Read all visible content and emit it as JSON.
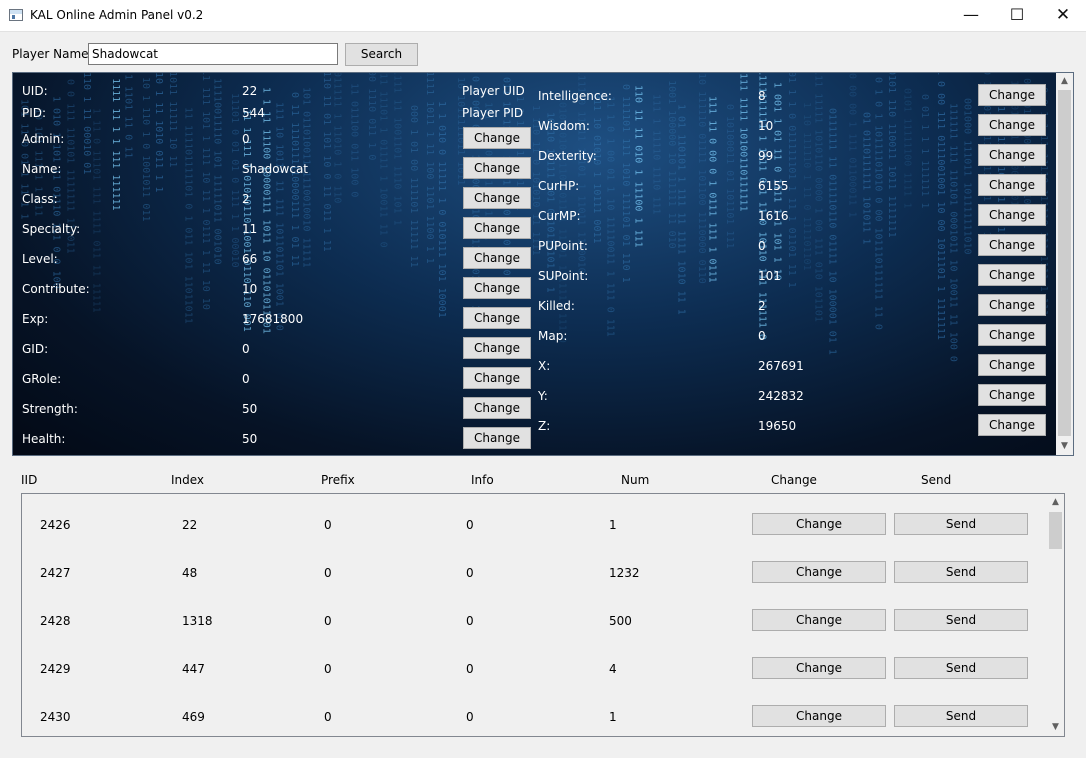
{
  "window": {
    "title": "KAL Online Admin Panel v0.2",
    "min_glyph": "—",
    "max_glyph": "☐",
    "close_glyph": "✕"
  },
  "search": {
    "label": "Player Name:",
    "value": "Shadowcat",
    "button": "Search"
  },
  "stats_left": [
    {
      "label": "UID:",
      "value": "22"
    },
    {
      "label": "PID:",
      "value": "544"
    },
    {
      "label": "Admin:",
      "value": "0"
    },
    {
      "label": "Name:",
      "value": "Shadowcat"
    },
    {
      "label": "Class:",
      "value": "2"
    },
    {
      "label": "Specialty:",
      "value": "11"
    },
    {
      "label": "Level:",
      "value": "66"
    },
    {
      "label": "Contribute:",
      "value": "10"
    },
    {
      "label": "Exp:",
      "value": "17681800"
    },
    {
      "label": "GID:",
      "value": "0"
    },
    {
      "label": "GRole:",
      "value": "0"
    },
    {
      "label": "Strength:",
      "value": "50"
    },
    {
      "label": "Health:",
      "value": "50"
    }
  ],
  "player_uid_label": "Player UID",
  "player_pid_label": "Player PID",
  "stats_right": [
    {
      "label": "Intelligence:",
      "value": "8"
    },
    {
      "label": "Wisdom:",
      "value": "10"
    },
    {
      "label": "Dexterity:",
      "value": "99"
    },
    {
      "label": "CurHP:",
      "value": "6155"
    },
    {
      "label": "CurMP:",
      "value": "1616"
    },
    {
      "label": "PUPoint:",
      "value": "0"
    },
    {
      "label": "SUPoint:",
      "value": "101"
    },
    {
      "label": "Killed:",
      "value": "2"
    },
    {
      "label": "Map:",
      "value": "0"
    },
    {
      "label": "X:",
      "value": "267691"
    },
    {
      "label": "Y:",
      "value": "242832"
    },
    {
      "label": "Z:",
      "value": "19650"
    }
  ],
  "change_label": "Change",
  "send_label": "Send",
  "items": {
    "headers": [
      "IID",
      "Index",
      "Prefix",
      "Info",
      "Num",
      "Change",
      "Send"
    ],
    "rows": [
      {
        "iid": "2426",
        "index": "22",
        "prefix": "0",
        "info": "0",
        "num": "1"
      },
      {
        "iid": "2427",
        "index": "48",
        "prefix": "0",
        "info": "0",
        "num": "1232"
      },
      {
        "iid": "2428",
        "index": "1318",
        "prefix": "0",
        "info": "0",
        "num": "500"
      },
      {
        "iid": "2429",
        "index": "447",
        "prefix": "0",
        "info": "0",
        "num": "4"
      },
      {
        "iid": "2430",
        "index": "469",
        "prefix": "0",
        "info": "0",
        "num": "1"
      }
    ]
  },
  "scroll_arrows": {
    "up": "▲",
    "down": "▼"
  }
}
